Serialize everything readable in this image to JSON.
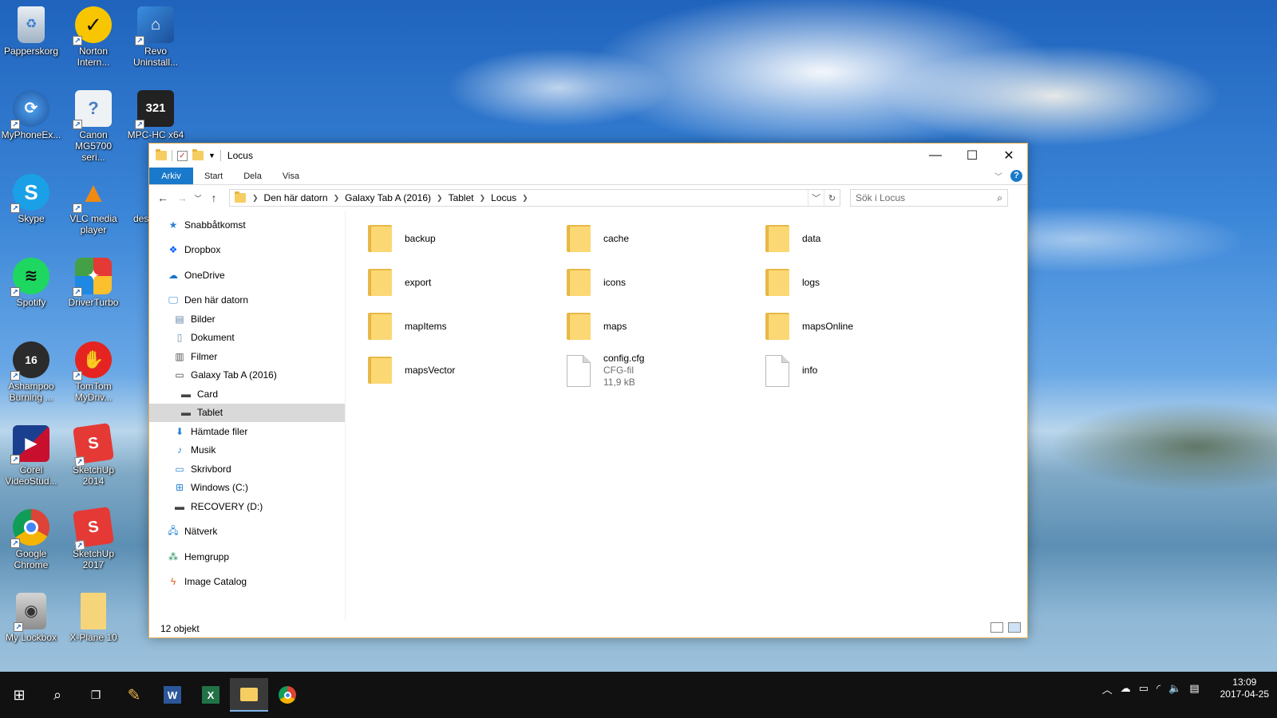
{
  "desktop": {
    "icons": [
      {
        "label": "Papperskorg",
        "icon": "recycle-bin-icon"
      },
      {
        "label": "Norton Intern...",
        "icon": "norton-icon"
      },
      {
        "label": "Revo Uninstall...",
        "icon": "revo-icon"
      },
      {
        "label": "MyPhoneEx...",
        "icon": "myphoneexplorer-icon"
      },
      {
        "label": "Canon MG5700 seri...",
        "icon": "canon-icon"
      },
      {
        "label": "MPC-HC x64",
        "icon": "mpc-hc-icon"
      },
      {
        "label": "Skype",
        "icon": "skype-icon"
      },
      {
        "label": "VLC media player",
        "icon": "vlc-icon"
      },
      {
        "label": "des",
        "icon": "partial-icon"
      },
      {
        "label": "Spotify",
        "icon": "spotify-icon"
      },
      {
        "label": "DriverTurbo",
        "icon": "driverturbo-icon"
      },
      {
        "label": "Ashampoo Burning ...",
        "icon": "ashampoo-icon"
      },
      {
        "label": "TomTom MyDriv...",
        "icon": "tomtom-icon"
      },
      {
        "label": "Corel VideoStud...",
        "icon": "corel-icon"
      },
      {
        "label": "SketchUp 2014",
        "icon": "sketchup-icon"
      },
      {
        "label": "Google Chrome",
        "icon": "chrome-icon"
      },
      {
        "label": "SketchUp 2017",
        "icon": "sketchup-icon"
      },
      {
        "label": "My Lockbox",
        "icon": "lockbox-icon"
      },
      {
        "label": "X-Plane 10",
        "icon": "folder-icon"
      }
    ]
  },
  "window": {
    "title": "Locus",
    "ribbon_tabs": [
      "Arkiv",
      "Start",
      "Dela",
      "Visa"
    ],
    "breadcrumb": [
      "Den här datorn",
      "Galaxy Tab A (2016)",
      "Tablet",
      "Locus"
    ],
    "search_placeholder": "Sök i Locus",
    "nav": {
      "quick_access": "Snabbåtkomst",
      "dropbox": "Dropbox",
      "onedrive": "OneDrive",
      "this_pc": "Den här datorn",
      "pictures": "Bilder",
      "documents": "Dokument",
      "videos": "Filmer",
      "device": "Galaxy Tab A (2016)",
      "card": "Card",
      "tablet": "Tablet",
      "downloads": "Hämtade filer",
      "music": "Musik",
      "desktop": "Skrivbord",
      "drive_c": "Windows (C:)",
      "drive_d": "RECOVERY (D:)",
      "network": "Nätverk",
      "homegroup": "Hemgrupp",
      "image_catalog": "Image Catalog"
    },
    "files": [
      {
        "name": "backup",
        "kind": "folder"
      },
      {
        "name": "cache",
        "kind": "folder"
      },
      {
        "name": "data",
        "kind": "folder"
      },
      {
        "name": "export",
        "kind": "folder"
      },
      {
        "name": "icons",
        "kind": "folder"
      },
      {
        "name": "logs",
        "kind": "folder"
      },
      {
        "name": "mapItems",
        "kind": "folder"
      },
      {
        "name": "maps",
        "kind": "folder"
      },
      {
        "name": "mapsOnline",
        "kind": "folder"
      },
      {
        "name": "mapsVector",
        "kind": "folder"
      },
      {
        "name": "config.cfg",
        "kind": "file",
        "type": "CFG-fil",
        "size": "11,9 kB"
      },
      {
        "name": "info",
        "kind": "file"
      }
    ],
    "status": "12 objekt"
  },
  "taskbar": {
    "time": "13:09",
    "date": "2017-04-25"
  },
  "colors": {
    "accent": "#1979ca",
    "folder": "#fcd874",
    "selection": "#d9d9d9",
    "taskbar": "#111111"
  }
}
